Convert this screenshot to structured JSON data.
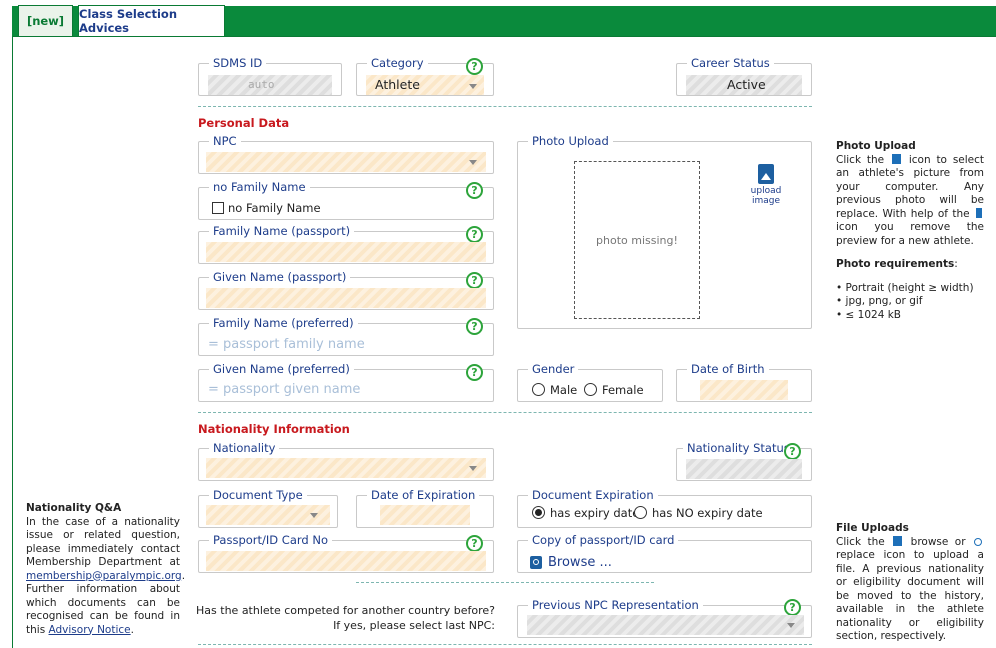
{
  "tabs": [
    {
      "label": "[new]"
    },
    {
      "label": "Class Selection Advices"
    }
  ],
  "sdms": {
    "legend": "SDMS ID",
    "value": "auto"
  },
  "category": {
    "legend": "Category",
    "value": "Athlete"
  },
  "career": {
    "legend": "Career Status",
    "value": "Active"
  },
  "personal": {
    "title": "Personal Data",
    "npc_legend": "NPC",
    "nofamily_legend": "no Family Name",
    "nofamily_checkbox": "no Family Name",
    "family_passport": "Family Name (passport)",
    "given_passport": "Given Name (passport)",
    "family_pref": "Family Name (preferred)",
    "family_pref_ph": "= passport family name",
    "given_pref": "Given Name (preferred)",
    "given_pref_ph": "= passport given name"
  },
  "photo": {
    "legend": "Photo Upload",
    "missing": "photo missing!",
    "upload_label": "upload image",
    "icon": "upload-image-icon"
  },
  "gender": {
    "legend": "Gender",
    "male": "Male",
    "female": "Female"
  },
  "dob": {
    "legend": "Date of Birth"
  },
  "nationality": {
    "title": "Nationality Information",
    "nat_legend": "Nationality",
    "status_legend": "Nationality Status",
    "doc_type": "Document Type",
    "date_exp": "Date of Expiration",
    "doc_exp": "Document Expiration",
    "has_exp": "has expiry date",
    "no_exp": "has NO expiry date",
    "passport_no": "Passport/ID Card No",
    "copy_legend": "Copy of passport/ID card",
    "browse": "Browse ...",
    "question_1": "Has the athlete competed for another country before?",
    "question_2": "If yes, please select last NPC:",
    "prev_npc": "Previous NPC Representation"
  },
  "help_glyph": "?",
  "sidebar_left": {
    "title": "Nationality Q&A",
    "text_1": "In the case of a nationality issue or related question, please immediately contact Membership Department at",
    "email": "membership@paralympic.org",
    "text_2": ". Further information about which documents can be recognised can be found in this",
    "link": "Advisory Notice",
    "text_3": "."
  },
  "sidebar_right": {
    "photo_title": "Photo Upload",
    "photo_text_1": "Click the",
    "photo_text_2": "icon to select an athlete's picture from your computer. Any previous photo will be replace. With help of the",
    "photo_text_3": "icon you remove the preview for a new athlete.",
    "req_title": "Photo requirements",
    "req_colon": ":",
    "req_items": [
      "Portrait (height ≥ width)",
      "jpg, png, or gif",
      "≤ 1024 kB"
    ],
    "files_title": "File Uploads",
    "files_text_1": "Click the",
    "files_text_2": "browse or",
    "files_text_3": "replace icon to upload a file. A previous nationality or eligibility document will be moved to the history, available in the athlete nationality or eligibility section, respectively."
  },
  "colors": {
    "brand_green": "#0a8a3c",
    "section_red": "#c8191e",
    "link_blue": "#1d3c8a",
    "help_green": "#2da43b"
  }
}
